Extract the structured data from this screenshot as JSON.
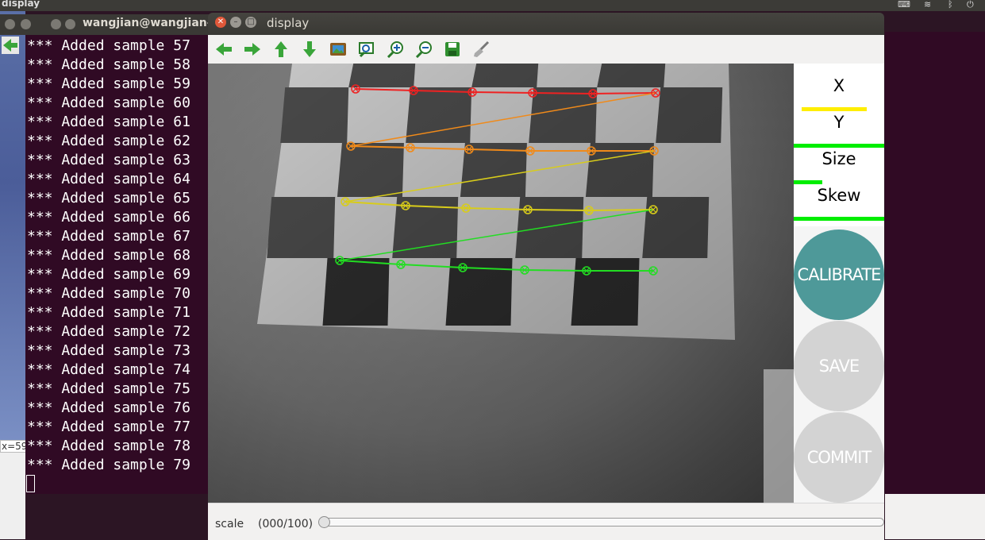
{
  "topbar": {
    "app_name": "display",
    "tray": {
      "keyboard": "keyboard-icon",
      "wifi": "wifi-icon",
      "bluetooth": "bluetooth-icon",
      "power": "power-icon"
    }
  },
  "terminal": {
    "title": "wangjian@wangjian-w",
    "lines": [
      "*** Added sample 57",
      "*** Added sample 58",
      "*** Added sample 59",
      "*** Added sample 60",
      "*** Added sample 61",
      "*** Added sample 62",
      "*** Added sample 63",
      "*** Added sample 64",
      "*** Added sample 65",
      "*** Added sample 66",
      "*** Added sample 67",
      "*** Added sample 68",
      "*** Added sample 69",
      "*** Added sample 70",
      "*** Added sample 71",
      "*** Added sample 72",
      "*** Added sample 73",
      "*** Added sample 74",
      "*** Added sample 75",
      "*** Added sample 76",
      "*** Added sample 77",
      "*** Added sample 78",
      "*** Added sample 79"
    ],
    "side_label": "x=59"
  },
  "display": {
    "title": "display",
    "toolbar": [
      "back-arrow-icon",
      "forward-arrow-icon",
      "up-arrow-icon",
      "down-arrow-icon",
      "image-icon",
      "zoom-fit-icon",
      "zoom-in-icon",
      "zoom-out-icon",
      "save-icon",
      "brush-icon"
    ],
    "meters": {
      "x_label": "X",
      "y_label": "Y",
      "size_label": "Size",
      "skew_label": "Skew"
    },
    "buttons": {
      "calibrate": "CALIBRATE",
      "save": "SAVE",
      "commit": "COMMIT"
    },
    "colors": {
      "calibrate_active": "#4e9999",
      "inactive": "#d3d3d3",
      "meter_good": "#00ee00",
      "meter_mid": "#ffee00"
    },
    "status": {
      "scale_label": "scale",
      "scale_value": "(000/100)",
      "scale_fraction": 0
    }
  }
}
